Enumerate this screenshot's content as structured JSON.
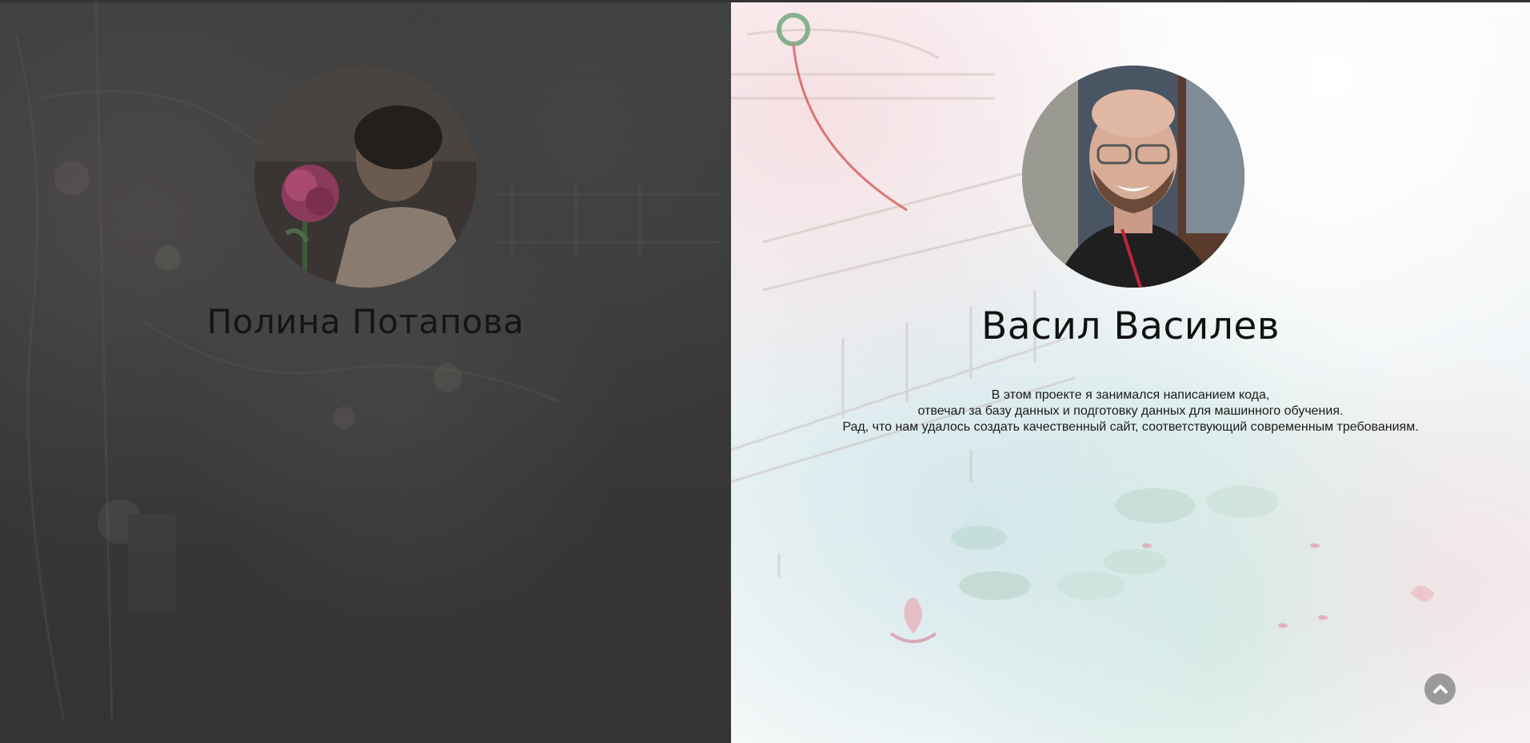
{
  "team": {
    "members": [
      {
        "name": "Полина Потапова",
        "bio_lines": []
      },
      {
        "name": "Васил Василев",
        "bio_lines": [
          "В этом проекте я занимался написанием кода,",
          "отвечал за базу данных и подготовку данных для машинного обучения.",
          "Рад, что нам удалось создать качественный сайт, соответствующий современным требованиям."
        ]
      }
    ]
  },
  "scroll_top": {
    "icon": "chevron-up-icon"
  },
  "colors": {
    "left_overlay": "#444444",
    "scroll_button": "#9a9a9a",
    "text": "#111111"
  }
}
